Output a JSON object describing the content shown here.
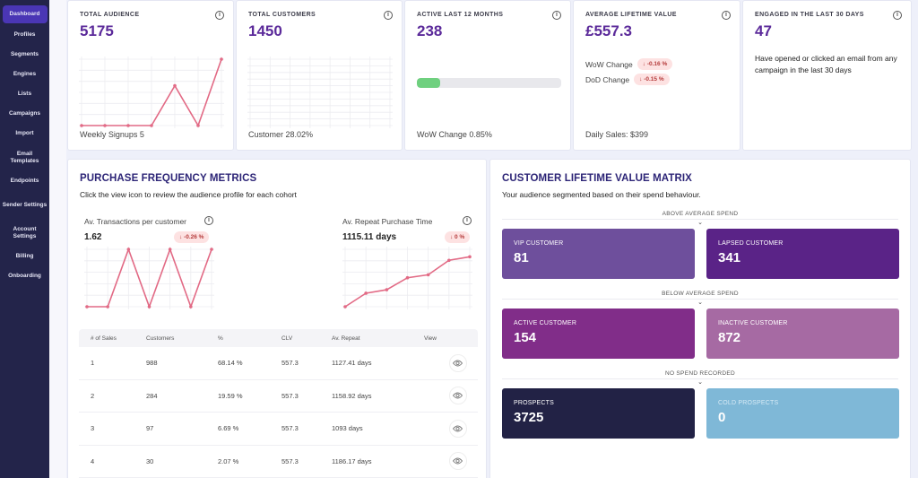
{
  "sidebar": {
    "items": [
      {
        "label": "Dashboard",
        "active": true
      },
      {
        "label": "Profiles"
      },
      {
        "label": "Segments"
      },
      {
        "label": "Engines"
      },
      {
        "label": "Lists"
      },
      {
        "label": "Campaigns"
      },
      {
        "label": "Import"
      },
      {
        "label": "Email Templates"
      },
      {
        "label": "Endpoints"
      },
      {
        "label": "Sender Settings"
      },
      {
        "label": "Account Settings"
      },
      {
        "label": "Billing"
      },
      {
        "label": "Onboarding"
      }
    ]
  },
  "stats": {
    "total_audience": {
      "label": "TOTAL AUDIENCE",
      "value": "5175",
      "footer": "Weekly Signups 5",
      "info_icon": "info-icon"
    },
    "total_customers": {
      "label": "TOTAL CUSTOMERS",
      "value": "1450",
      "footer": "Customer 28.02%",
      "info_icon": "info-icon"
    },
    "active_12m": {
      "label": "ACTIVE LAST 12 MONTHS",
      "value": "238",
      "footer": "WoW Change 0.85%",
      "progress_fraction": 0.16,
      "info_icon": "info-icon"
    },
    "avg_ltv": {
      "label": "AVERAGE LIFETIME VALUE",
      "value": "£557.3",
      "wow_label": "WoW Change",
      "wow_badge": "↓ -0.16 %",
      "dod_label": "DoD Change",
      "dod_badge": "↓ -0.15 %",
      "footer": "Daily Sales: $399",
      "info_icon": "info-icon"
    },
    "engaged_30d": {
      "label": "ENGAGED IN THE LAST 30 DAYS",
      "value": "47",
      "description": "Have opened or clicked an email from any campaign in the last 30 days",
      "info_icon": "info-icon"
    }
  },
  "purchase_frequency": {
    "title": "PURCHASE FREQUENCY METRICS",
    "subtitle": "Click the view icon to review the audience profile for each cohort",
    "transactions": {
      "label": "Av. Transactions per customer",
      "value": "1.62",
      "badge": "↓ -0.26 %"
    },
    "repeat_time": {
      "label": "Av. Repeat Purchase Time",
      "value": "1115.11 days",
      "badge": "↓ 0 %"
    },
    "table": {
      "headers": [
        "# of Sales",
        "Customers",
        "%",
        "CLV",
        "Av. Repeat",
        "View"
      ],
      "rows": [
        [
          "1",
          "988",
          "68.14 %",
          "557.3",
          "1127.41 days"
        ],
        [
          "2",
          "284",
          "19.59 %",
          "557.3",
          "1158.92 days"
        ],
        [
          "3",
          "97",
          "6.69 %",
          "557.3",
          "1093 days"
        ],
        [
          "4",
          "30",
          "2.07 %",
          "557.3",
          "1186.17 days"
        ]
      ]
    }
  },
  "clv_matrix": {
    "title": "CUSTOMER LIFETIME VALUE MATRIX",
    "subtitle": "Your audience segmented based on their spend behaviour.",
    "groups": [
      {
        "label": "ABOVE AVERAGE SPEND"
      },
      {
        "label": "BELOW AVERAGE SPEND"
      },
      {
        "label": "NO SPEND RECORDED"
      }
    ],
    "segments": [
      {
        "label": "VIP CUSTOMER",
        "value": "81",
        "color": "#6e4f9c"
      },
      {
        "label": "LAPSED CUSTOMER",
        "value": "341",
        "color": "#5a2387"
      },
      {
        "label": "ACTIVE CUSTOMER",
        "value": "154",
        "color": "#812d89"
      },
      {
        "label": "INACTIVE CUSTOMER",
        "value": "872",
        "color": "#a66aa3"
      },
      {
        "label": "PROSPECTS",
        "value": "3725",
        "color": "#222245"
      },
      {
        "label": "COLD PROSPECTS",
        "value": "0",
        "color": "#7fb8d7"
      }
    ]
  },
  "colors": {
    "sidebar_bg": "#23244a",
    "active_nav": "#4a36b5",
    "stat_value": "#5b2a9a",
    "line": "#e26a85",
    "progress": "#6fd07f"
  },
  "chart_data": [
    {
      "type": "line",
      "title": "Weekly Signups",
      "x": [
        1,
        2,
        3,
        4,
        5,
        6,
        7
      ],
      "values": [
        0,
        0,
        0,
        0,
        3,
        0,
        5
      ],
      "ylim": [
        0,
        5
      ],
      "grid": true
    },
    {
      "type": "line",
      "title": "Total Customers",
      "x": [
        1,
        2,
        3,
        4,
        5,
        6,
        7
      ],
      "values": [],
      "grid": true
    },
    {
      "type": "line",
      "title": "Av. Transactions per customer",
      "x": [
        1,
        2,
        3,
        4,
        5,
        6,
        7
      ],
      "values": [
        0,
        0,
        1,
        0,
        1,
        0,
        1
      ],
      "ylim": [
        0,
        1
      ],
      "grid": true
    },
    {
      "type": "line",
      "title": "Av. Repeat Purchase Time",
      "x": [
        1,
        2,
        3,
        4,
        5,
        6,
        7
      ],
      "values": [
        0,
        0.27,
        0.34,
        0.58,
        0.64,
        0.93,
        1
      ],
      "ylim": [
        0,
        1.15
      ],
      "grid": true
    }
  ]
}
